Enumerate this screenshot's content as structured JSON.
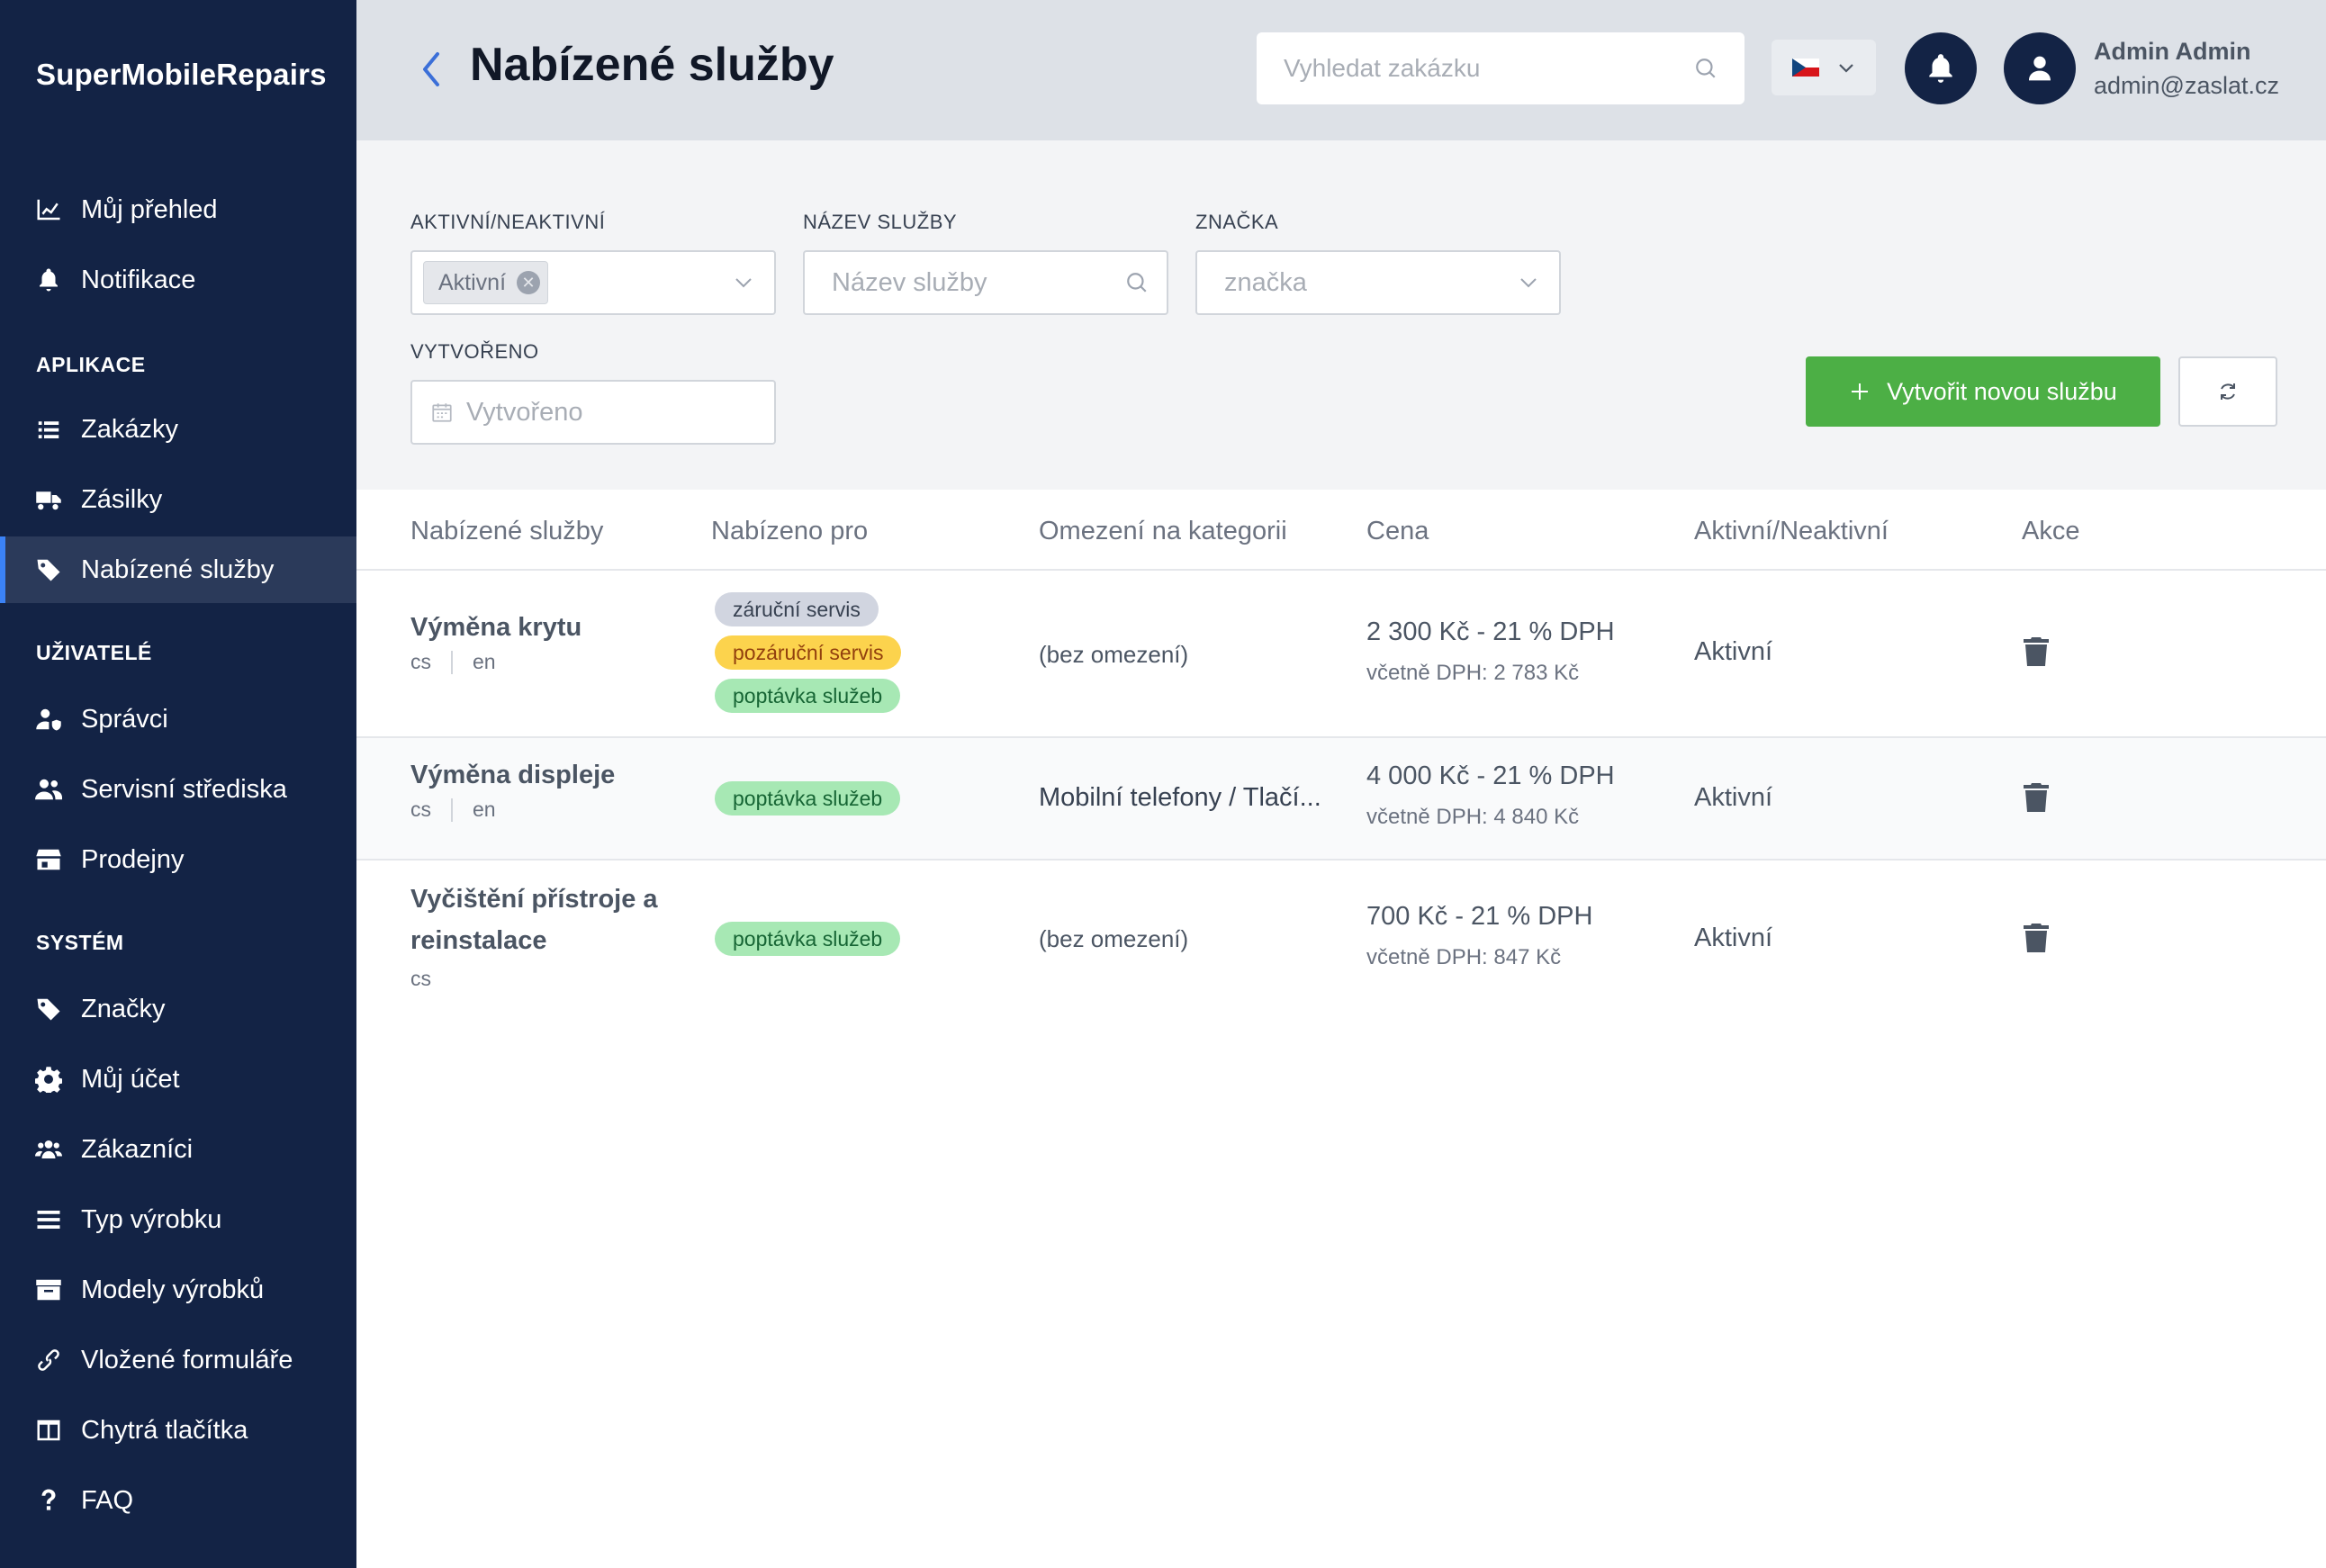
{
  "sidebar": {
    "brand": "SuperMobileRepairs",
    "top_items": [
      {
        "label": "Můj přehled",
        "icon": "chart-line-icon"
      },
      {
        "label": "Notifikace",
        "icon": "bell-icon"
      }
    ],
    "sections": [
      {
        "title": "APLIKACE",
        "items": [
          {
            "label": "Zakázky",
            "icon": "list-icon"
          },
          {
            "label": "Zásilky",
            "icon": "truck-icon"
          },
          {
            "label": "Nabízené služby",
            "icon": "tag-icon",
            "active": true
          }
        ]
      },
      {
        "title": "UŽIVATELÉ",
        "items": [
          {
            "label": "Správci",
            "icon": "user-shield-icon"
          },
          {
            "label": "Servisní střediska",
            "icon": "users-icon"
          },
          {
            "label": "Prodejny",
            "icon": "store-icon"
          }
        ]
      },
      {
        "title": "SYSTÉM",
        "items": [
          {
            "label": "Značky",
            "icon": "tag-icon"
          },
          {
            "label": "Můj účet",
            "icon": "gear-icon"
          },
          {
            "label": "Zákazníci",
            "icon": "users-group-icon"
          },
          {
            "label": "Typ výrobku",
            "icon": "bars-icon"
          },
          {
            "label": "Modely výrobků",
            "icon": "archive-icon"
          },
          {
            "label": "Vložené formuláře",
            "icon": "link-icon"
          },
          {
            "label": "Chytrá tlačítka",
            "icon": "columns-icon"
          },
          {
            "label": "FAQ",
            "icon": "question-icon"
          }
        ]
      }
    ]
  },
  "header": {
    "title": "Nabízené služby",
    "search_placeholder": "Vyhledat zakázku",
    "user_name": "Admin Admin",
    "user_email": "admin@zaslat.cz"
  },
  "filters": {
    "active_label": "AKTIVNÍ/NEAKTIVNÍ",
    "active_tag": "Aktivní",
    "name_label": "NÁZEV SLUŽBY",
    "name_placeholder": "Název služby",
    "brand_label": "ZNAČKA",
    "brand_placeholder": "značka",
    "created_label": "VYTVOŘENO",
    "created_placeholder": "Vytvořeno"
  },
  "actions": {
    "create_label": "Vytvořit novou službu"
  },
  "table": {
    "columns": [
      "Nabízené služby",
      "Nabízeno pro",
      "Omezení na kategorii",
      "Cena",
      "Aktivní/Neaktivní",
      "Akce"
    ],
    "rows": [
      {
        "name_lines": [
          "Výměna krytu"
        ],
        "langs": [
          "cs",
          "en"
        ],
        "badges": [
          {
            "text": "záruční servis",
            "color": "gray"
          },
          {
            "text": "pozáruční servis",
            "color": "yellow"
          },
          {
            "text": "poptávka služeb",
            "color": "green"
          }
        ],
        "category": "(bez omezení)",
        "price": "2 300 Kč - 21 % DPH",
        "price_vat": "včetně DPH: 2 783 Kč",
        "status": "Aktivní"
      },
      {
        "name_lines": [
          "Výměna displeje"
        ],
        "langs": [
          "cs",
          "en"
        ],
        "badges": [
          {
            "text": "poptávka služeb",
            "color": "green"
          }
        ],
        "category": "Mobilní telefony / Tlačí...",
        "price": "4 000 Kč - 21 % DPH",
        "price_vat": "včetně DPH: 4 840 Kč",
        "status": "Aktivní"
      },
      {
        "name_lines": [
          "Vyčištění přístroje a",
          "reinstalace"
        ],
        "langs": [
          "cs"
        ],
        "badges": [
          {
            "text": "poptávka služeb",
            "color": "green"
          }
        ],
        "category": "(bez omezení)",
        "price": "700 Kč - 21 % DPH",
        "price_vat": "včetně DPH: 847 Kč",
        "status": "Aktivní"
      }
    ]
  }
}
